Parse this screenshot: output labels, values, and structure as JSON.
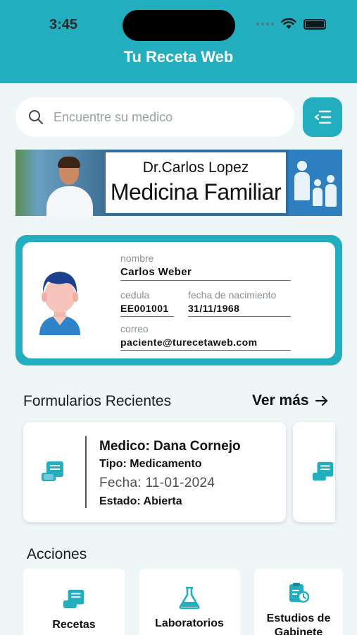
{
  "status_bar": {
    "time": "3:45"
  },
  "header": {
    "title": "Tu Receta Web"
  },
  "search": {
    "placeholder": "Encuentre su medico"
  },
  "banner": {
    "doctor_name": "Dr.Carlos Lopez",
    "specialty": "Medicina Familiar"
  },
  "patient": {
    "name_label": "nombre",
    "name": "Carlos Weber",
    "id_label": "cedula",
    "id": "EE001001",
    "birth_label": "fecha de nacimiento",
    "birth": "31/11/1968",
    "email_label": "correo",
    "email": "paciente@turecetaweb.com"
  },
  "recent_forms": {
    "title": "Formularios Recientes",
    "see_more": "Ver más",
    "items": [
      {
        "doctor": "Medico: Dana Cornejo",
        "type": "Tipo: Medicamento",
        "date": "Fecha: 11-01-2024",
        "status": "Estado: Abierta"
      }
    ]
  },
  "actions": {
    "title": "Acciones",
    "items": [
      {
        "label": "Recetas",
        "icon": "prescription-icon"
      },
      {
        "label": "Laboratorios",
        "icon": "flask-icon"
      },
      {
        "label": "Estudios de Gabinete",
        "icon": "clipboard-clock-icon"
      }
    ]
  },
  "colors": {
    "accent": "#22aebf",
    "background": "#eef6f8"
  }
}
